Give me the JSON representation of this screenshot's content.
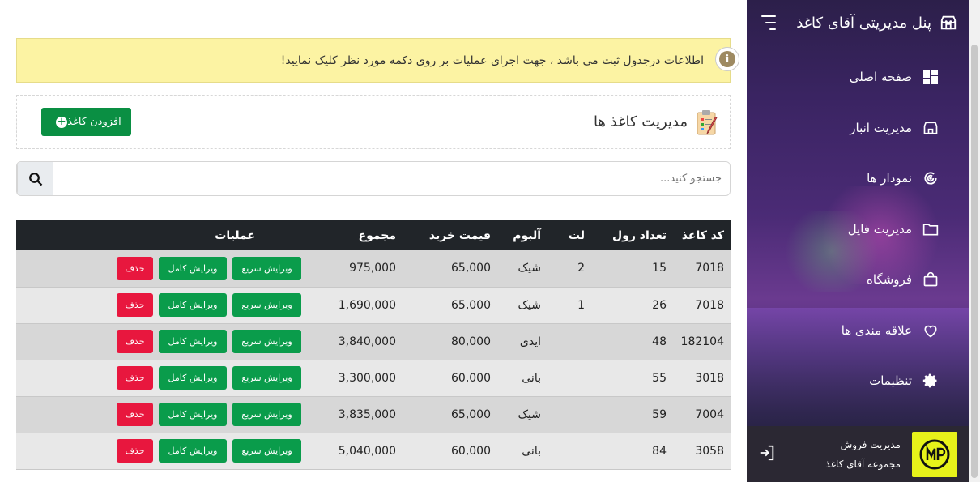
{
  "sidebar": {
    "title": "پنل مدیریتی آقای کاغذ",
    "items": [
      {
        "label": "صفحه اصلی",
        "icon": "dashboard-icon"
      },
      {
        "label": "مدیریت انبار",
        "icon": "store-icon"
      },
      {
        "label": "نمودار ها",
        "icon": "chart-icon"
      },
      {
        "label": "مدیریت فایل",
        "icon": "folder-icon"
      },
      {
        "label": "فروشگاه",
        "icon": "shopping-bag-icon"
      },
      {
        "label": "علاقه مندی ها",
        "icon": "heart-icon"
      },
      {
        "label": "تنظیمات",
        "icon": "gear-icon"
      }
    ],
    "footer": {
      "line1": "مدیریت فروش",
      "line2": "مجموعه آقای کاغذ",
      "badge_color": "#e7f21a"
    }
  },
  "alert": {
    "message": "اطلاعات درجدول ثبت می باشد ، جهت اجرای عملیات بر روی دکمه مورد نظر کلیک نمایید!"
  },
  "card": {
    "title": "مدیریت کاغذ ها",
    "add_label": "افزودن کاغذ"
  },
  "search": {
    "placeholder": "جستجو کنید..."
  },
  "table": {
    "headers": [
      "کد کاغذ",
      "تعداد رول",
      "لت",
      "آلبوم",
      "قیمت خرید",
      "مجموع",
      "عملیات"
    ],
    "buttons": {
      "quick_edit": "ویرایش سریع",
      "full_edit": "ویرایش کامل",
      "delete": "حذف"
    },
    "rows": [
      [
        "7018",
        "15",
        "2",
        "شیک",
        "65,000",
        "975,000"
      ],
      [
        "7018",
        "26",
        "1",
        "شیک",
        "65,000",
        "1,690,000"
      ],
      [
        "182104",
        "48",
        "",
        "ایدی",
        "80,000",
        "3,840,000"
      ],
      [
        "3018",
        "55",
        "",
        "بانی",
        "60,000",
        "3,300,000"
      ],
      [
        "7004",
        "59",
        "",
        "شیک",
        "65,000",
        "3,835,000"
      ],
      [
        "3058",
        "84",
        "",
        "بانی",
        "60,000",
        "5,040,000"
      ]
    ]
  },
  "colors": {
    "green": "#0a9c4b",
    "red": "#e8173e",
    "alert_bg": "#fcf3a3",
    "header_bg": "#212529"
  }
}
